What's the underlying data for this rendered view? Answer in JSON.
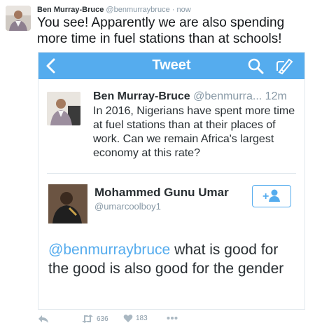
{
  "tweet": {
    "author_name": "Ben Murray-Bruce",
    "author_handle": "@benmurraybruce",
    "separator": "·",
    "time": "now",
    "text": "You see! Apparently we are also spending more time in fuel stations than at schools!"
  },
  "screenshot": {
    "appbar": {
      "title": "Tweet",
      "icons": [
        "back-chevron-icon",
        "search-icon",
        "compose-icon"
      ],
      "bg_color": "#55acee"
    },
    "quoted": {
      "name": "Ben Murray-Bruce",
      "handle": "@benmurra...",
      "time": "12m",
      "text": "In 2016, Nigerians have spent more time at fuel stations than at their places of work. Can we remain Africa's largest economy at this rate?"
    },
    "reply": {
      "name": "Mohammed Gunu Umar",
      "handle": "@umarcoolboy1",
      "mention": "@benmurraybruce",
      "text": " what is good for the good is also good for the gender",
      "follow_icon": "follow-user-icon"
    }
  },
  "actions": {
    "reply_icon": "reply-icon",
    "retweet_count": "636",
    "like_count": "183",
    "more_icon": "more-icon"
  }
}
